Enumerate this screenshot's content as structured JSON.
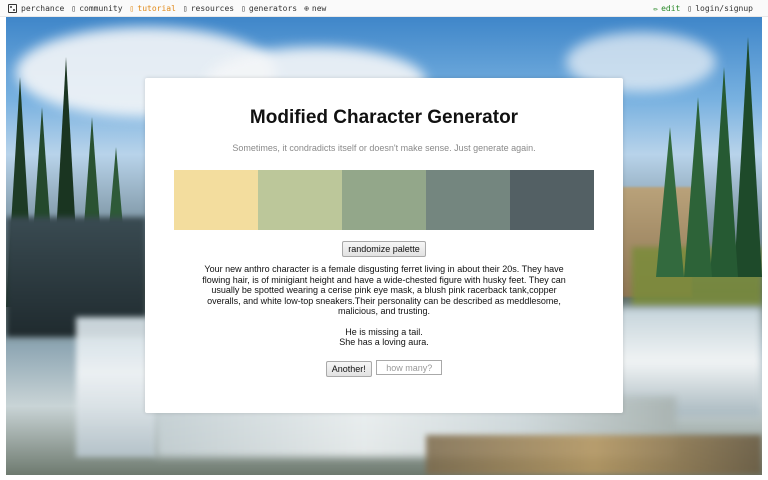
{
  "nav": {
    "brand": "perchance",
    "items": [
      {
        "icon": "person-icon",
        "glyph": "▯",
        "label": "community"
      },
      {
        "icon": "lightbulb-icon",
        "glyph": "▯",
        "label": "tutorial"
      },
      {
        "icon": "book-icon",
        "glyph": "▯",
        "label": "resources"
      },
      {
        "icon": "dice-icon",
        "glyph": "▯",
        "label": "generators"
      },
      {
        "icon": "plus-icon",
        "glyph": "⊕",
        "label": "new"
      }
    ],
    "edit": {
      "glyph": "✏",
      "label": "edit"
    },
    "login": {
      "glyph": "▯",
      "label": "login/signup"
    }
  },
  "card": {
    "title": "Modified Character Generator",
    "subtitle": "Sometimes, it condradicts itself or doesn't make sense. Just generate again.",
    "palette": [
      "#f3dd9e",
      "#bcc79a",
      "#93a78a",
      "#74867f",
      "#536064"
    ],
    "randomize_label": "randomize palette",
    "description": [
      "Your new anthro character is a female disgusting ferret living in about their 20s. They have",
      "flowing hair, is of minigiant height and have a wide-chested figure with husky feet. They can",
      "usually be spotted wearing a cerise pink eye mask, a blush pink racerback tank,copper",
      "overalls, and white low-top sneakers.Their personality can be described as meddlesome,",
      "malicious, and trusting."
    ],
    "extra": [
      "He is missing a tail.",
      "She has a loving aura."
    ],
    "another_label": "Another!",
    "count_placeholder": "how many?"
  },
  "colors": {
    "accent_tutorial": "#e08a1a",
    "accent_edit": "#2a8a2a"
  }
}
